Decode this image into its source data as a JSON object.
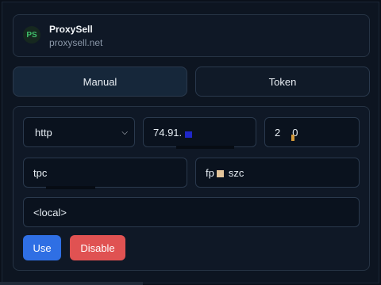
{
  "header": {
    "logo_text": "PS",
    "brand_name": "ProxySell",
    "domain": "proxysell.net"
  },
  "tabs": {
    "manual": "Manual",
    "token": "Token"
  },
  "form": {
    "protocol": "http",
    "host": "74.91.",
    "port_start": "2",
    "port_end": "0",
    "username": "tpc",
    "password_start": "fp",
    "password_end": "szc",
    "bypass": "<local>"
  },
  "buttons": {
    "use": "Use",
    "disable": "Disable"
  },
  "colors": {
    "accent_blue": "#2f6fe4",
    "danger_red": "#e05252",
    "logo_green": "#3fbf6a"
  },
  "icons": {
    "select_arrow": "chevron-down-icon"
  }
}
